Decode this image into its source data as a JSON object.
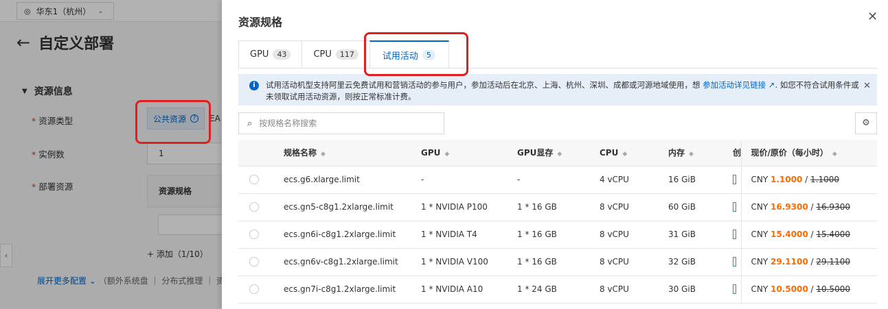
{
  "background": {
    "region": "华东1（杭州）",
    "page_title": "自定义部署",
    "section_title": "资源信息",
    "labels": {
      "resource_type": "资源类型",
      "instance_count": "实例数",
      "deploy_resource": "部署资源"
    },
    "public_resource_button": "公共资源",
    "ea_fragment": "EA",
    "instance_count_value": "1",
    "resource_spec_header": "资源规格",
    "add_label": "+ 添加（1/10）",
    "expand_link": "展开更多配置",
    "expand_rest": "（额外系统盘 ｜ 分布式推理 ｜ 资"
  },
  "drawer": {
    "title": "资源规格",
    "tabs": [
      {
        "label": "GPU",
        "count": "43",
        "active": false
      },
      {
        "label": "CPU",
        "count": "117",
        "active": false
      },
      {
        "label": "试用活动",
        "count": "5",
        "active": true
      }
    ],
    "notice": {
      "text_before_link": "试用活动机型支持阿里云免费试用和营销活动的参与用户，参加活动后在北京、上海、杭州、深圳、成都或河源地域使用，想 ",
      "link": "参加活动详见链接",
      "text_after_link": ". 如您不符合试用条件或未领取试用活动资源，则按正常标准计费。"
    },
    "search_placeholder": "按规格名称搜索",
    "table": {
      "headers": {
        "name": "规格名称",
        "gpu": "GPU",
        "gpu_mem": "GPU显存",
        "cpu": "CPU",
        "memory": "内存",
        "truncated": "创",
        "price": "现价/原价（每小时）"
      },
      "rows": [
        {
          "name": "ecs.g6.xlarge.limit",
          "gpu": "-",
          "gpu_mem": "-",
          "cpu": "4 vCPU",
          "memory": "16 GiB",
          "currency": "CNY",
          "price": "1.1000",
          "orig": "1.1000"
        },
        {
          "name": "ecs.gn5-c8g1.2xlarge.limit",
          "gpu": "1 * NVIDIA P100",
          "gpu_mem": "1 * 16 GB",
          "cpu": "8 vCPU",
          "memory": "60 GiB",
          "currency": "CNY",
          "price": "16.9300",
          "orig": "16.9300"
        },
        {
          "name": "ecs.gn6i-c8g1.2xlarge.limit",
          "gpu": "1 * NVIDIA T4",
          "gpu_mem": "1 * 16 GB",
          "cpu": "8 vCPU",
          "memory": "31 GiB",
          "currency": "CNY",
          "price": "15.4000",
          "orig": "15.4000"
        },
        {
          "name": "ecs.gn6v-c8g1.2xlarge.limit",
          "gpu": "1 * NVIDIA V100",
          "gpu_mem": "1 * 16 GB",
          "cpu": "8 vCPU",
          "memory": "32 GiB",
          "currency": "CNY",
          "price": "29.1100",
          "orig": "29.1100"
        },
        {
          "name": "ecs.gn7i-c8g1.2xlarge.limit",
          "gpu": "1 * NVIDIA A10",
          "gpu_mem": "1 * 24 GB",
          "cpu": "8 vCPU",
          "memory": "30 GiB",
          "currency": "CNY",
          "price": "10.5000",
          "orig": "10.5000"
        }
      ]
    }
  },
  "colors": {
    "accent": "#0064c8",
    "price": "#ff6a00",
    "highlight_box": "#e02020"
  },
  "icons": [
    "location-pin-icon",
    "chevron-down-icon",
    "back-arrow-icon",
    "caret-down-icon",
    "help-icon",
    "close-icon",
    "info-icon",
    "external-link-icon",
    "search-icon",
    "gear-icon",
    "sort-icon",
    "chevron-left-icon"
  ]
}
